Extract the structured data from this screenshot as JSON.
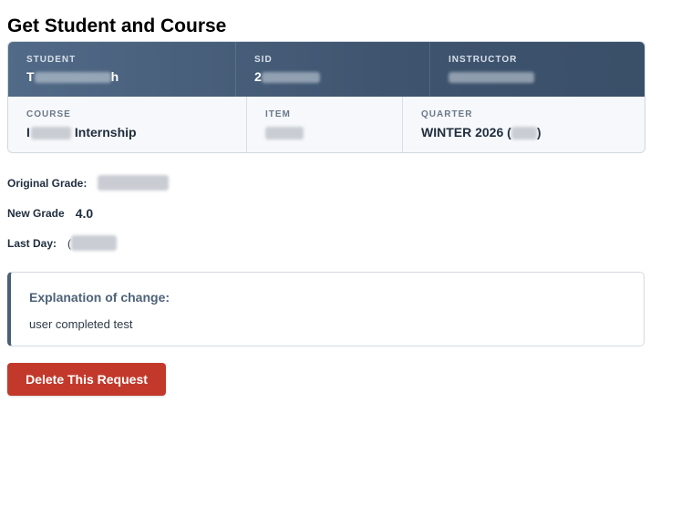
{
  "page": {
    "title": "Get Student and Course"
  },
  "summary_card": {
    "student": {
      "label": "STUDENT",
      "value_start": "T",
      "value_end": "h"
    },
    "sid": {
      "label": "SID",
      "value_start": "2"
    },
    "instructor": {
      "label": "INSTRUCTOR"
    },
    "course": {
      "label": "COURSE",
      "value_start": "I",
      "value_end": "Internship"
    },
    "item": {
      "label": "ITEM"
    },
    "quarter": {
      "label": "QUARTER",
      "value_start": "WINTER 2026 (",
      "value_end": ")"
    }
  },
  "fields": {
    "original_grade_label": "Original Grade:",
    "new_grade_label": "New Grade",
    "new_grade_value": "4.0",
    "last_day_label": "Last Day:",
    "last_day_value_start": "("
  },
  "explanation": {
    "title": "Explanation of change:",
    "text": "user completed test"
  },
  "actions": {
    "delete_label": "Delete This Request"
  },
  "colors": {
    "header_band": "#46607c",
    "delete_button": "#c2392b",
    "accent_border": "#4a5f78"
  }
}
